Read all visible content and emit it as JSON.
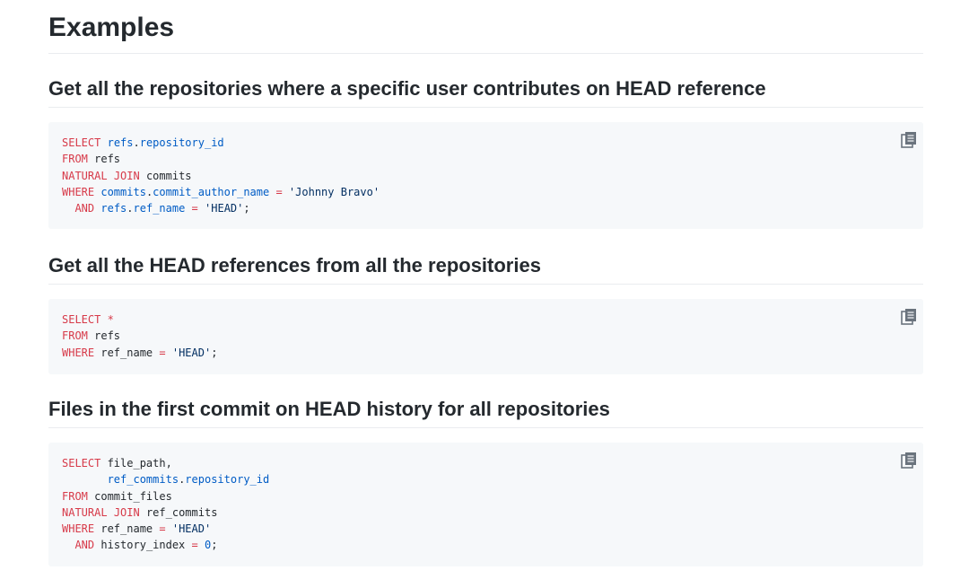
{
  "page": {
    "title": "Examples"
  },
  "icons": {
    "copy": "copy-icon"
  },
  "colors": {
    "keyword": "#d73a49",
    "identifier": "#005cc5",
    "string": "#032f62",
    "code_background": "#f6f8fa"
  },
  "examples": [
    {
      "title": "Get all the repositories where a specific user contributes on HEAD reference",
      "code": [
        [
          [
            "kw",
            "SELECT"
          ],
          [
            "t",
            " "
          ],
          [
            "id",
            "refs"
          ],
          [
            "t",
            "."
          ],
          [
            "id",
            "repository_id"
          ]
        ],
        [
          [
            "kw",
            "FROM"
          ],
          [
            "t",
            " refs"
          ]
        ],
        [
          [
            "kw",
            "NATURAL"
          ],
          [
            "t",
            " "
          ],
          [
            "kw",
            "JOIN"
          ],
          [
            "t",
            " commits"
          ]
        ],
        [
          [
            "kw",
            "WHERE"
          ],
          [
            "t",
            " "
          ],
          [
            "id",
            "commits"
          ],
          [
            "t",
            "."
          ],
          [
            "id",
            "commit_author_name"
          ],
          [
            "t",
            " "
          ],
          [
            "kw",
            "="
          ],
          [
            "t",
            " "
          ],
          [
            "str",
            "'Johnny Bravo'"
          ]
        ],
        [
          [
            "t",
            "  "
          ],
          [
            "kw",
            "AND"
          ],
          [
            "t",
            " "
          ],
          [
            "id",
            "refs"
          ],
          [
            "t",
            "."
          ],
          [
            "id",
            "ref_name"
          ],
          [
            "t",
            " "
          ],
          [
            "kw",
            "="
          ],
          [
            "t",
            " "
          ],
          [
            "str",
            "'HEAD'"
          ],
          [
            "t",
            ";"
          ]
        ]
      ]
    },
    {
      "title": "Get all the HEAD references from all the repositories",
      "code": [
        [
          [
            "kw",
            "SELECT"
          ],
          [
            "t",
            " "
          ],
          [
            "kw",
            "*"
          ]
        ],
        [
          [
            "kw",
            "FROM"
          ],
          [
            "t",
            " refs"
          ]
        ],
        [
          [
            "kw",
            "WHERE"
          ],
          [
            "t",
            " ref_name "
          ],
          [
            "kw",
            "="
          ],
          [
            "t",
            " "
          ],
          [
            "str",
            "'HEAD'"
          ],
          [
            "t",
            ";"
          ]
        ]
      ]
    },
    {
      "title": "Files in the first commit on HEAD history for all repositories",
      "code": [
        [
          [
            "kw",
            "SELECT"
          ],
          [
            "t",
            " file_path,"
          ]
        ],
        [
          [
            "t",
            "       "
          ],
          [
            "id",
            "ref_commits"
          ],
          [
            "t",
            "."
          ],
          [
            "id",
            "repository_id"
          ]
        ],
        [
          [
            "kw",
            "FROM"
          ],
          [
            "t",
            " commit_files"
          ]
        ],
        [
          [
            "kw",
            "NATURAL"
          ],
          [
            "t",
            " "
          ],
          [
            "kw",
            "JOIN"
          ],
          [
            "t",
            " ref_commits"
          ]
        ],
        [
          [
            "kw",
            "WHERE"
          ],
          [
            "t",
            " ref_name "
          ],
          [
            "kw",
            "="
          ],
          [
            "t",
            " "
          ],
          [
            "str",
            "'HEAD'"
          ]
        ],
        [
          [
            "t",
            "  "
          ],
          [
            "kw",
            "AND"
          ],
          [
            "t",
            " history_index "
          ],
          [
            "kw",
            "="
          ],
          [
            "t",
            " "
          ],
          [
            "num",
            "0"
          ],
          [
            "t",
            ";"
          ]
        ]
      ]
    }
  ]
}
